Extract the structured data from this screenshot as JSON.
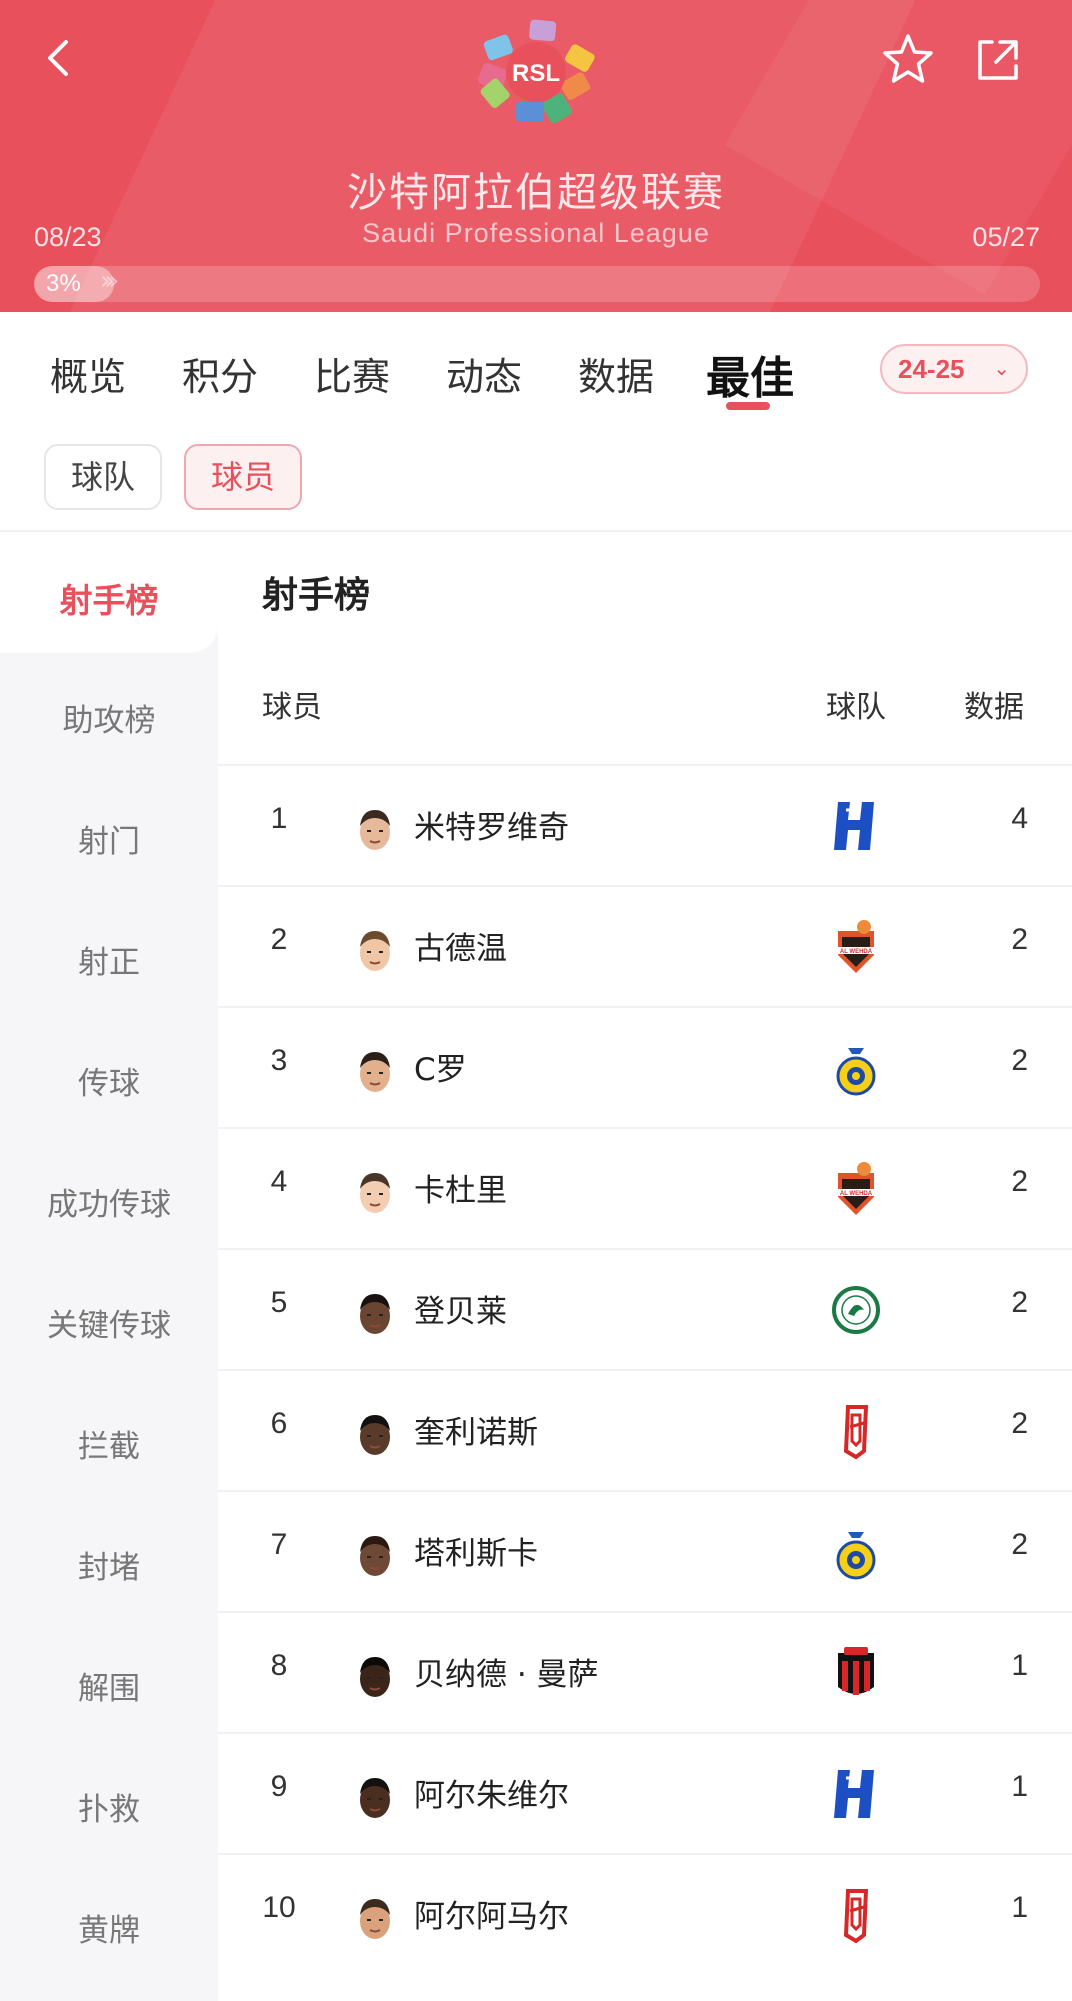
{
  "header": {
    "league_logo_text": "RSL",
    "title_cn": "沙特阿拉伯超级联赛",
    "title_en": "Saudi Professional League",
    "date_start": "08/23",
    "date_end": "05/27",
    "progress_label": "3%",
    "progress_value": 0.03,
    "accent_color": "#e8505c",
    "icons": [
      "chevron-left-icon",
      "star-icon",
      "share-icon"
    ]
  },
  "tabs": [
    {
      "label": "概览",
      "active": false
    },
    {
      "label": "积分",
      "active": false
    },
    {
      "label": "比赛",
      "active": false
    },
    {
      "label": "动态",
      "active": false
    },
    {
      "label": "数据",
      "active": false
    },
    {
      "label": "最佳",
      "active": true
    }
  ],
  "season": {
    "label": "24-25",
    "icon": "chevron-down-icon"
  },
  "subtabs": {
    "team": "球队",
    "player": "球员",
    "selected": "player"
  },
  "sidebar": {
    "items": [
      {
        "label": "射手榜",
        "active": true
      },
      {
        "label": "助攻榜",
        "active": false
      },
      {
        "label": "射门",
        "active": false
      },
      {
        "label": "射正",
        "active": false
      },
      {
        "label": "传球",
        "active": false
      },
      {
        "label": "成功传球",
        "active": false
      },
      {
        "label": "关键传球",
        "active": false
      },
      {
        "label": "拦截",
        "active": false
      },
      {
        "label": "封堵",
        "active": false
      },
      {
        "label": "解围",
        "active": false
      },
      {
        "label": "扑救",
        "active": false
      },
      {
        "label": "黄牌",
        "active": false
      }
    ]
  },
  "ranking": {
    "title": "射手榜",
    "columns": {
      "player": "球员",
      "team": "球队",
      "value": "数据"
    },
    "rows": [
      {
        "rank": "1",
        "player": "米特罗维奇",
        "team_badge": "al-hilal",
        "value": "4"
      },
      {
        "rank": "2",
        "player": "古德温",
        "team_badge": "al-wehda",
        "value": "2"
      },
      {
        "rank": "3",
        "player": "C罗",
        "team_badge": "al-nassr",
        "value": "2"
      },
      {
        "rank": "4",
        "player": "卡杜里",
        "team_badge": "al-wehda",
        "value": "2"
      },
      {
        "rank": "5",
        "player": "登贝莱",
        "team_badge": "ettifaq",
        "value": "2"
      },
      {
        "rank": "6",
        "player": "奎利诺斯",
        "team_badge": "al-qadsiah",
        "value": "2"
      },
      {
        "rank": "7",
        "player": "塔利斯卡",
        "team_badge": "al-nassr",
        "value": "2"
      },
      {
        "rank": "8",
        "player": "贝纳德 · 曼萨",
        "team_badge": "al-riyadh",
        "value": "1"
      },
      {
        "rank": "9",
        "player": "阿尔朱维尔",
        "team_badge": "al-hilal",
        "value": "1"
      },
      {
        "rank": "10",
        "player": "阿尔阿马尔",
        "team_badge": "al-qadsiah",
        "value": "1"
      }
    ]
  }
}
